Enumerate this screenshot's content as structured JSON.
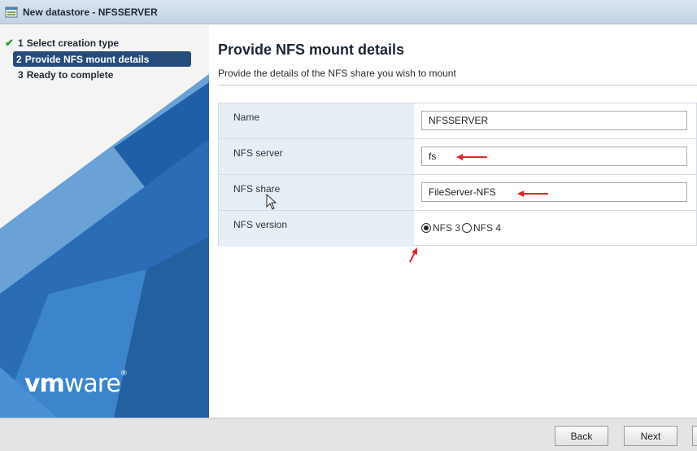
{
  "window": {
    "title": "New datastore - NFSSERVER"
  },
  "steps": [
    {
      "number": "1",
      "label": "Select creation type",
      "state": "completed"
    },
    {
      "number": "2",
      "label": "Provide NFS mount details",
      "state": "active"
    },
    {
      "number": "3",
      "label": "Ready to complete",
      "state": "pending"
    }
  ],
  "brand": {
    "logo_bold": "vm",
    "logo_light": "ware",
    "reg": "®"
  },
  "page": {
    "title": "Provide NFS mount details",
    "subtitle": "Provide the details of the NFS share you wish to mount"
  },
  "form": {
    "name": {
      "label": "Name",
      "value": "NFSSERVER"
    },
    "server": {
      "label": "NFS server",
      "value": "fs"
    },
    "share": {
      "label": "NFS share",
      "value": "FileServer-NFS"
    },
    "version": {
      "label": "NFS version",
      "options": [
        "NFS 3",
        "NFS 4"
      ],
      "selected": "NFS 3"
    }
  },
  "footer": {
    "back_label": "Back",
    "next_label": "Next"
  },
  "colors": {
    "accent_blue": "#2b73bd",
    "active_step": "#254c7a",
    "annotation_red": "#e0262b",
    "check_green": "#2e9e2e"
  }
}
